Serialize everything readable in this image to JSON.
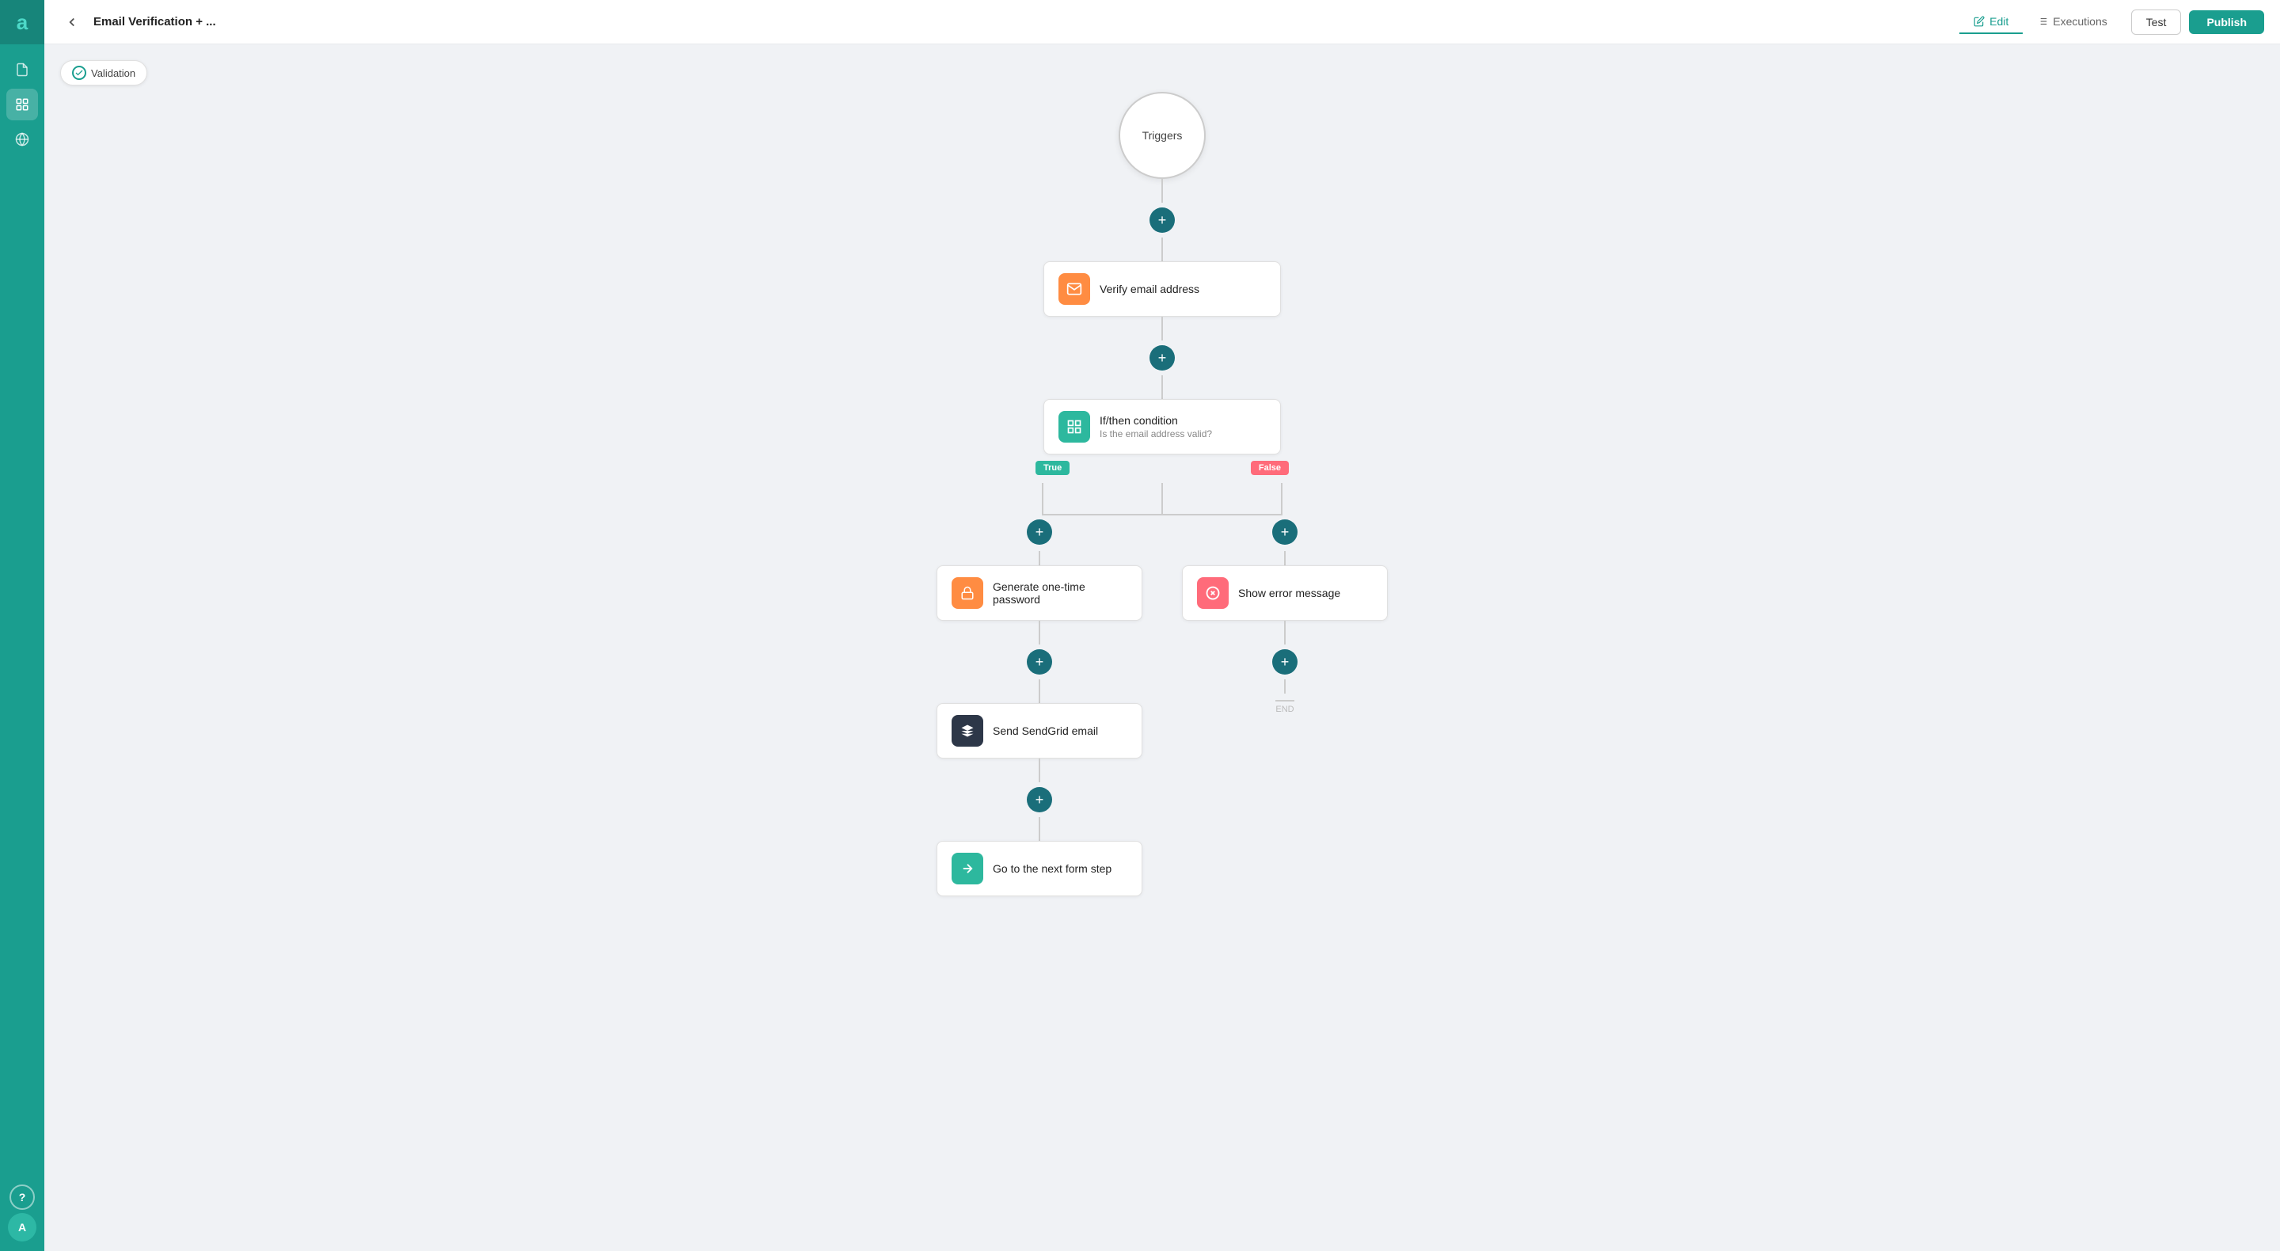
{
  "app": {
    "logo_letter": "a",
    "title": "Email Verification + ...",
    "back_button_label": "←"
  },
  "header": {
    "tabs": [
      {
        "id": "edit",
        "label": "Edit",
        "active": true
      },
      {
        "id": "executions",
        "label": "Executions",
        "active": false
      }
    ],
    "test_button": "Test",
    "publish_button": "Publish"
  },
  "sidebar": {
    "items": [
      {
        "id": "document",
        "icon": "📄",
        "active": false
      },
      {
        "id": "workflow",
        "icon": "⚡",
        "active": true
      },
      {
        "id": "globe",
        "icon": "🌐",
        "active": false
      }
    ],
    "bottom": [
      {
        "id": "help",
        "icon": "?"
      },
      {
        "id": "avatar",
        "label": "A"
      }
    ]
  },
  "canvas": {
    "validation_badge": "Validation",
    "flow": {
      "trigger": "Triggers",
      "nodes": [
        {
          "id": "verify-email",
          "icon_type": "orange",
          "icon_symbol": "✉",
          "title": "Verify email address",
          "subtitle": ""
        },
        {
          "id": "if-then",
          "icon_type": "green",
          "icon_symbol": "⊞",
          "title": "If/then condition",
          "subtitle": "Is the email address valid?"
        }
      ],
      "branches": {
        "true_label": "True",
        "false_label": "False",
        "true_branch": [
          {
            "id": "generate-otp",
            "icon_type": "orange",
            "icon_symbol": "🔒",
            "title": "Generate one-time\npassword",
            "subtitle": ""
          },
          {
            "id": "send-sendgrid",
            "icon_type": "dark",
            "icon_symbol": "✦",
            "title": "Send SendGrid email",
            "subtitle": ""
          },
          {
            "id": "next-form-step",
            "icon_type": "teal",
            "icon_symbol": "→",
            "title": "Go to the next form step",
            "subtitle": ""
          }
        ],
        "false_branch": [
          {
            "id": "show-error",
            "icon_type": "pink",
            "icon_symbol": "✕",
            "title": "Show error message",
            "subtitle": ""
          }
        ]
      }
    }
  }
}
